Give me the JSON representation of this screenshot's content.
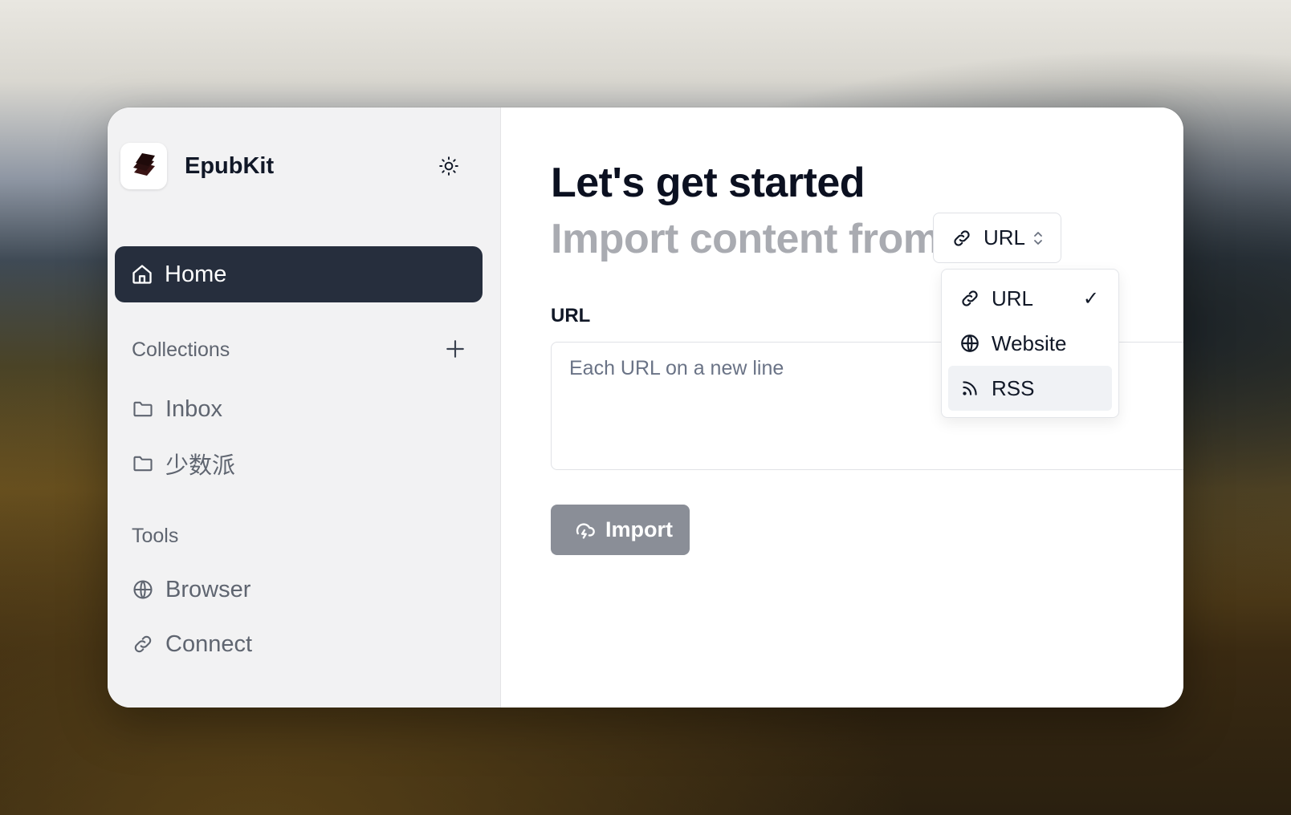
{
  "app": {
    "name": "EpubKit"
  },
  "sidebar": {
    "home_label": "Home",
    "collections_title": "Collections",
    "collections": [
      {
        "label": "Inbox",
        "icon": "folder-icon"
      },
      {
        "label": "少数派",
        "icon": "folder-icon"
      }
    ],
    "tools_title": "Tools",
    "tools": [
      {
        "label": "Browser",
        "icon": "globe-icon"
      },
      {
        "label": "Connect",
        "icon": "link-icon"
      }
    ]
  },
  "main": {
    "title": "Let's get started",
    "subtitle": "Import content from",
    "source_select": {
      "value": "URL",
      "options": [
        {
          "label": "URL",
          "icon": "link-icon",
          "selected": true
        },
        {
          "label": "Website",
          "icon": "globe-icon",
          "selected": false
        },
        {
          "label": "RSS",
          "icon": "rss-icon",
          "selected": false,
          "highlighted": true
        }
      ]
    },
    "field_label": "URL",
    "url_placeholder": "Each URL on a new line",
    "url_value": "",
    "import_label": "Import"
  },
  "colors": {
    "active_nav": "#262e3d",
    "sidebar_bg": "#f2f2f3",
    "import_button": "#8a8e97",
    "subtitle_gray": "#a9abb1"
  }
}
